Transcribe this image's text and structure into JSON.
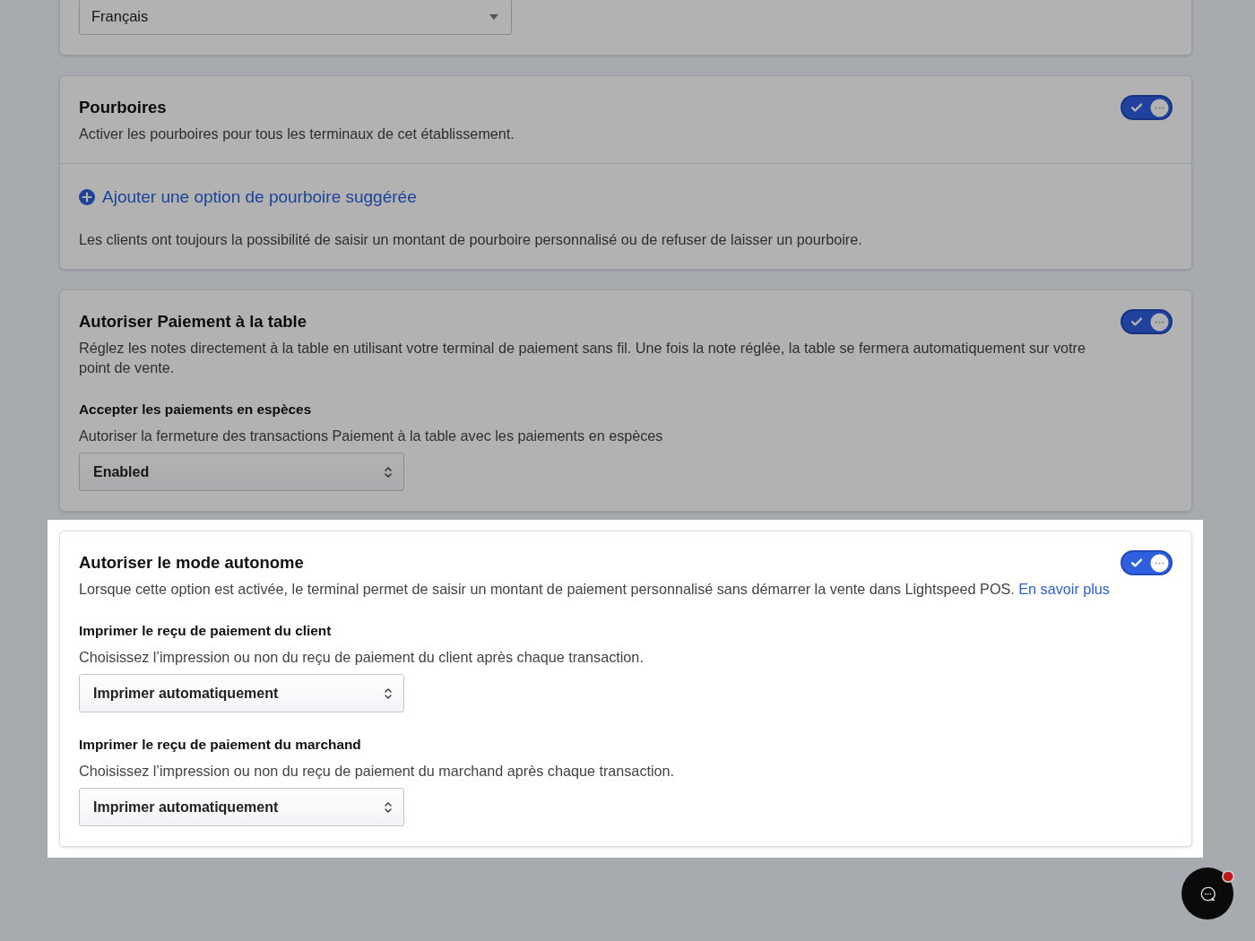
{
  "language_card": {
    "highlighted": false,
    "select": {
      "value": "Français"
    }
  },
  "sections": [
    {
      "kind": "tips",
      "highlighted": false,
      "title": "Pourboires",
      "description": "Activer les pourboires pour tous les terminaux de cet établissement.",
      "toggle": {
        "on": true
      },
      "add_link": "Ajouter une option de pourboire suggérée",
      "note": "Les clients ont toujours la possibilité de saisir un montant de pourboire personnalisé ou de refuser de laisser un pourboire."
    },
    {
      "kind": "settings",
      "highlighted": false,
      "title": "Autoriser Paiement à la table",
      "description": "Réglez les notes directement à la table en utilisant votre terminal de paiement sans fil. Une fois la note réglée, la table se fermera automatiquement sur votre point de vente.",
      "toggle": {
        "on": true
      },
      "settings": [
        {
          "label": "Accepter les paiements en espèces",
          "description": "Autoriser la fermeture des transactions Paiement à la table avec les paiements en espèces",
          "select": {
            "value": "Enabled"
          }
        }
      ]
    },
    {
      "kind": "settings",
      "highlighted": true,
      "title": "Autoriser le mode autonome",
      "description": "Lorsque cette option est activée, le terminal permet de saisir un montant de paiement personnalisé sans démarrer la vente dans Lightspeed POS.",
      "link": "En savoir plus",
      "toggle": {
        "on": true
      },
      "settings": [
        {
          "label": "Imprimer le reçu de paiement du client",
          "description": "Choisissez l’impression ou non du reçu de paiement du client après chaque transaction.",
          "select": {
            "value": "Imprimer automatiquement"
          }
        },
        {
          "label": "Imprimer le reçu de paiement du marchand",
          "description": "Choisissez l’impression ou non du reçu de paiement du marchand après chaque transaction.",
          "select": {
            "value": "Imprimer automatiquement"
          }
        }
      ]
    }
  ],
  "chat_button": {
    "notification": true
  }
}
